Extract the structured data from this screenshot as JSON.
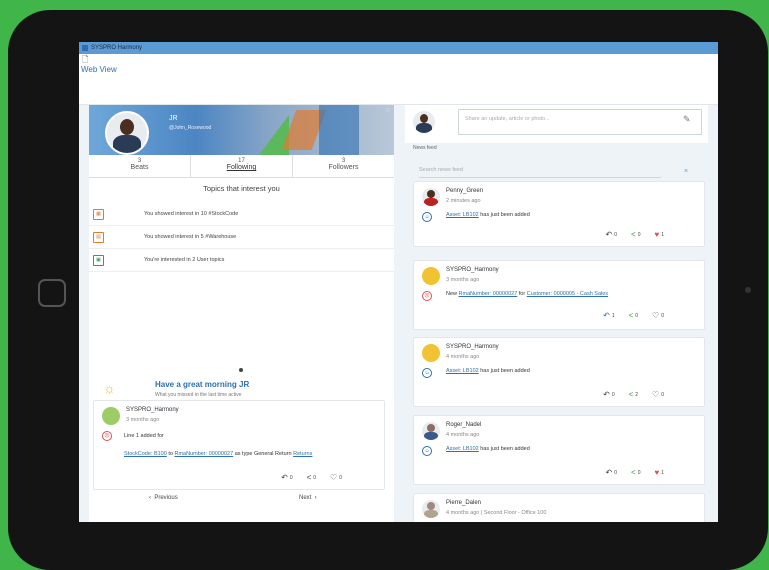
{
  "window": {
    "title": "SYSPRO Harmony",
    "section": "Web View"
  },
  "profile": {
    "name": "JR",
    "handle": "@John_Rosewood",
    "stats": [
      {
        "count": "3",
        "label": "Beats"
      },
      {
        "count": "17",
        "label": "Following"
      },
      {
        "count": "3",
        "label": "Followers"
      }
    ]
  },
  "topics": {
    "title": "Topics that interest you",
    "items": [
      {
        "text": "You showed interest in 10 #StockCode",
        "icon": "stock-code-icon"
      },
      {
        "text": "You showed interest in 5 #Warehouse",
        "icon": "warehouse-icon"
      },
      {
        "text": "You're interested in 2 User topics",
        "icon": "user-topics-icon"
      }
    ]
  },
  "greeting": {
    "title": "Have a great morning JR",
    "subtitle": "What you missed in the last time active"
  },
  "left_post": {
    "author": "SYSPRO_Harmony",
    "time": "3 months ago",
    "line1": "Line 1 added for",
    "link1": "StockCode: B100",
    "to": "to",
    "link2": "RmaNumber: 00000027",
    "tail": "as type General Return",
    "tail_link": "Returns",
    "reply_count": "0",
    "share_count": "0",
    "like_count": "0"
  },
  "pager": {
    "prev": "Previous",
    "next": "Next"
  },
  "composer": {
    "placeholder": "Share an update, article or photo..."
  },
  "feed": {
    "label": "News feed",
    "search_placeholder": "Search news feed",
    "posts": [
      {
        "author": "Penny_Green",
        "time": "2 minutes ago",
        "pre": "",
        "link": "Asset: LB102",
        "text": "has just been added",
        "link2": "",
        "reply": "0",
        "share": "0",
        "like": "1"
      },
      {
        "author": "SYSPRO_Harmony",
        "time": "3 months ago",
        "pre": "New",
        "link": "RmaNumber: 00000027",
        "text": "for",
        "link2": "Customer: 0000005 - Cash Sales",
        "reply": "1",
        "share": "0",
        "like": "0"
      },
      {
        "author": "SYSPRO_Harmony",
        "time": "4 months ago",
        "pre": "",
        "link": "Asset: LB102",
        "text": "has just been added",
        "link2": "",
        "reply": "0",
        "share": "2",
        "like": "0"
      },
      {
        "author": "Roger_Nadel",
        "time": "4 months ago",
        "pre": "",
        "link": "Asset: LB102",
        "text": "has just been added",
        "link2": "",
        "reply": "0",
        "share": "0",
        "like": "1"
      },
      {
        "author": "Pierre_Dalen",
        "time": "4 months ago | Second Floor - Office 100"
      }
    ]
  },
  "colors": {
    "accent": "#2f6fb3",
    "share": "#3c9b4a",
    "like": "#d9534f",
    "bezel": "#141414",
    "background": "#3fb54a"
  }
}
